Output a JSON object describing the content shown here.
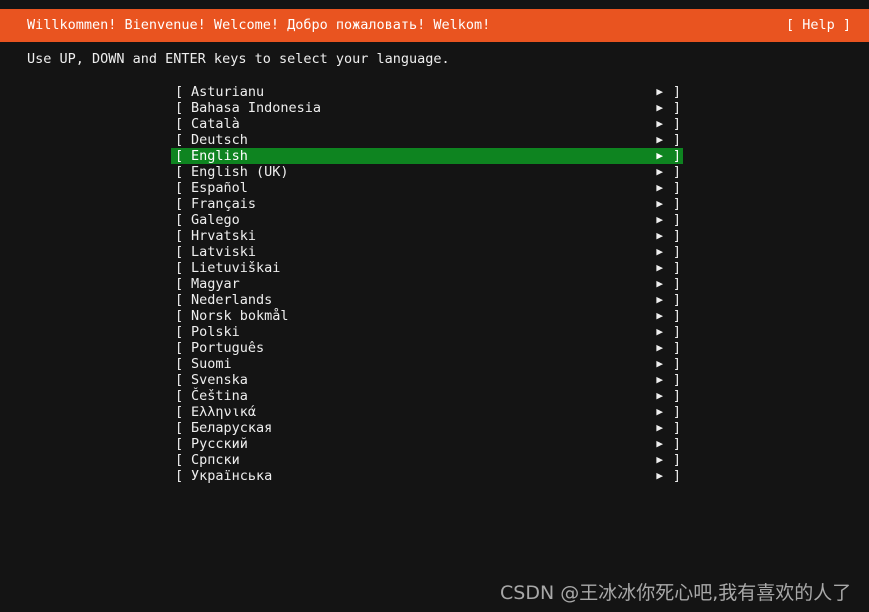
{
  "header": {
    "title": "Willkommen! Bienvenue! Welcome! Добро пожаловать! Welkom!",
    "help_label": "[ Help ]",
    "background_color": "#E95420",
    "text_color": "#FFFFFF"
  },
  "instruction": {
    "text": "Use UP, DOWN and ENTER keys to select your language."
  },
  "list": {
    "bracket_open": "[",
    "bracket_close": "]",
    "arrow_icon": "▶",
    "selected_index": 4,
    "selection_color": "#0E8420",
    "items": [
      {
        "label": "Asturianu"
      },
      {
        "label": "Bahasa Indonesia"
      },
      {
        "label": "Català"
      },
      {
        "label": "Deutsch"
      },
      {
        "label": "English"
      },
      {
        "label": "English (UK)"
      },
      {
        "label": "Español"
      },
      {
        "label": "Français"
      },
      {
        "label": "Galego"
      },
      {
        "label": "Hrvatski"
      },
      {
        "label": "Latviski"
      },
      {
        "label": "Lietuviškai"
      },
      {
        "label": "Magyar"
      },
      {
        "label": "Nederlands"
      },
      {
        "label": "Norsk bokmål"
      },
      {
        "label": "Polski"
      },
      {
        "label": "Português"
      },
      {
        "label": "Suomi"
      },
      {
        "label": "Svenska"
      },
      {
        "label": "Čeština"
      },
      {
        "label": "Ελληνικά"
      },
      {
        "label": "Беларуская"
      },
      {
        "label": "Русский"
      },
      {
        "label": "Српски"
      },
      {
        "label": "Українська"
      }
    ]
  },
  "watermark": {
    "text": "CSDN @王冰冰你死心吧,我有喜欢的人了"
  },
  "theme": {
    "background": "#141414",
    "foreground": "#EEEEEE"
  }
}
